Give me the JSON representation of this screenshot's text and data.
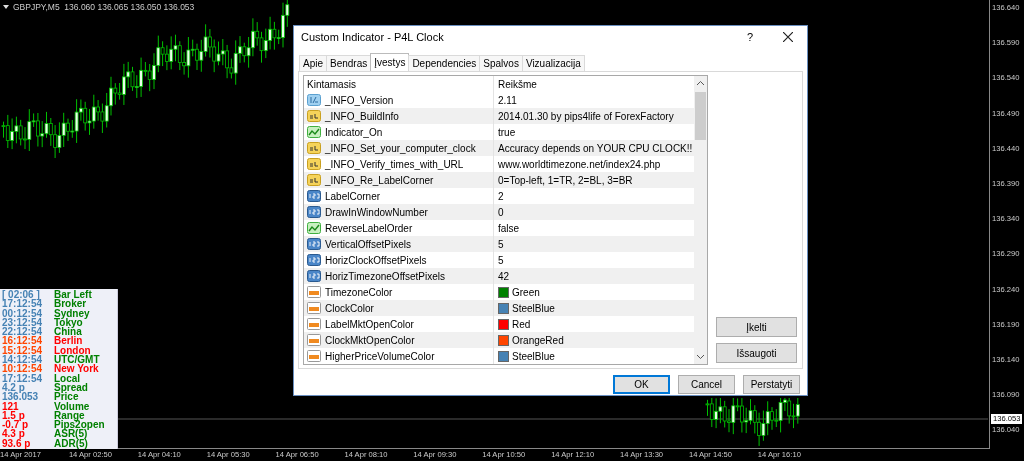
{
  "chart": {
    "symbol_line": "GBPJPY,M5  136.060 136.065 136.050 136.053",
    "price_labels": [
      "136.640",
      "136.590",
      "136.540",
      "136.490",
      "136.440",
      "136.390",
      "136.340",
      "136.290",
      "136.240",
      "136.190",
      "136.140",
      "136.090",
      "136.040"
    ],
    "current_price": "136.053",
    "time_labels": [
      "14 Apr 2017",
      "14 Apr 02:50",
      "14 Apr 04:10",
      "14 Apr 05:30",
      "14 Apr 06:50",
      "14 Apr 08:10",
      "14 Apr 09:30",
      "14 Apr 10:50",
      "14 Apr 12:10",
      "14 Apr 13:30",
      "14 Apr 14:50",
      "14 Apr 16:10"
    ]
  },
  "clock_panel": {
    "rows": [
      {
        "value": {
          "text": "[ 02:06 ]",
          "color": "#4682b4"
        },
        "label": {
          "text": "Bar Left",
          "color": "#008000"
        }
      },
      {
        "value": {
          "text": "17:12:54",
          "color": "#4682b4"
        },
        "label": {
          "text": "Broker",
          "color": "#008000"
        }
      },
      {
        "value": {
          "text": "00:12:54",
          "color": "#4682b4"
        },
        "label": {
          "text": "Sydney",
          "color": "#008000"
        }
      },
      {
        "value": {
          "text": "23:12:54",
          "color": "#4682b4"
        },
        "label": {
          "text": "Tokyo",
          "color": "#008000"
        }
      },
      {
        "value": {
          "text": "22:12:54",
          "color": "#4682b4"
        },
        "label": {
          "text": "China",
          "color": "#008000"
        }
      },
      {
        "value": {
          "text": "16:12:54",
          "color": "#ff4500"
        },
        "label": {
          "text": "Berlin",
          "color": "#ff0000"
        }
      },
      {
        "value": {
          "text": "15:12:54",
          "color": "#ff4500"
        },
        "label": {
          "text": "London",
          "color": "#ff0000"
        }
      },
      {
        "value": {
          "text": "14:12:54",
          "color": "#4682b4"
        },
        "label": {
          "text": "UTC/GMT",
          "color": "#008000"
        }
      },
      {
        "value": {
          "text": "10:12:54",
          "color": "#ff4500"
        },
        "label": {
          "text": "New York",
          "color": "#ff0000"
        }
      },
      {
        "value": {
          "text": "17:12:54",
          "color": "#4682b4"
        },
        "label": {
          "text": "Local",
          "color": "#008000"
        }
      },
      {
        "value": {
          "text": "4.2 p",
          "color": "#4682b4"
        },
        "label": {
          "text": "Spread",
          "color": "#008000"
        }
      },
      {
        "value": {
          "text": "136.053",
          "color": "#4682b4"
        },
        "label": {
          "text": "Price",
          "color": "#008000"
        }
      },
      {
        "value": {
          "text": "121",
          "color": "#ff0000"
        },
        "label": {
          "text": "Volume",
          "color": "#008000"
        }
      },
      {
        "value": {
          "text": "1.5 p",
          "color": "#ff0000"
        },
        "label": {
          "text": "Range",
          "color": "#008000"
        }
      },
      {
        "value": {
          "text": "-0.7 p",
          "color": "#ff0000"
        },
        "label": {
          "text": "Pips2open",
          "color": "#008000"
        }
      },
      {
        "value": {
          "text": "4.3 p",
          "color": "#ff0000"
        },
        "label": {
          "text": "ASR(5)",
          "color": "#008000"
        }
      },
      {
        "value": {
          "text": "93.6 p",
          "color": "#ff0000"
        },
        "label": {
          "text": "ADR(5)",
          "color": "#008000"
        }
      }
    ]
  },
  "dialog": {
    "title": "Custom Indicator - P4L Clock",
    "help": "?",
    "tabs": [
      {
        "label": "Apie",
        "selected": false
      },
      {
        "label": "Bendras",
        "selected": false
      },
      {
        "label": "Įvestys",
        "selected": true
      },
      {
        "label": "Dependencies",
        "selected": false
      },
      {
        "label": "Spalvos",
        "selected": false
      },
      {
        "label": "Vizualizacija",
        "selected": false
      }
    ],
    "table": {
      "columns": [
        "Kintamasis",
        "Reikšme"
      ],
      "rows": [
        {
          "kind": "version",
          "name": "_INFO_Version",
          "value": "2.11"
        },
        {
          "kind": "string",
          "name": "_INFO_BuildInfo",
          "value": "2014.01.30 by pips4life of ForexFactory"
        },
        {
          "kind": "bool",
          "name": "Indicator_On",
          "value": "true"
        },
        {
          "kind": "string",
          "name": "_INFO_Set_your_computer_clock",
          "value": "Accuracy depends on YOUR CPU CLOCK!!"
        },
        {
          "kind": "string",
          "name": "_INFO_Verify_times_with_URL",
          "value": "www.worldtimezone.net/index24.php"
        },
        {
          "kind": "string",
          "name": "_INFO_Re_LabelCorner",
          "value": "0=Top-left, 1=TR, 2=BL, 3=BR"
        },
        {
          "kind": "int",
          "name": "LabelCorner",
          "value": "2"
        },
        {
          "kind": "int",
          "name": "DrawInWindowNumber",
          "value": "0"
        },
        {
          "kind": "bool",
          "name": "ReverseLabelOrder",
          "value": "false"
        },
        {
          "kind": "int",
          "name": "VerticalOffsetPixels",
          "value": "5"
        },
        {
          "kind": "int",
          "name": "HorizClockOffsetPixels",
          "value": "5"
        },
        {
          "kind": "int",
          "name": "HorizTimezoneOffsetPixels",
          "value": "42"
        },
        {
          "kind": "color",
          "name": "TimezoneColor",
          "value": "Green",
          "color": "#008000"
        },
        {
          "kind": "color",
          "name": "ClockColor",
          "value": "SteelBlue",
          "color": "#4682b4"
        },
        {
          "kind": "color",
          "name": "LabelMktOpenColor",
          "value": "Red",
          "color": "#ff0000"
        },
        {
          "kind": "color",
          "name": "ClockMktOpenColor",
          "value": "OrangeRed",
          "color": "#ff4500"
        },
        {
          "kind": "color",
          "name": "HigherPriceVolumeColor",
          "value": "SteelBlue",
          "color": "#4682b4"
        }
      ]
    },
    "side_buttons": [
      "Įkelti",
      "Išsaugoti"
    ],
    "buttons": [
      {
        "label": "OK",
        "default": true
      },
      {
        "label": "Cancel",
        "default": false
      },
      {
        "label": "Perstatyti",
        "default": false
      }
    ]
  }
}
